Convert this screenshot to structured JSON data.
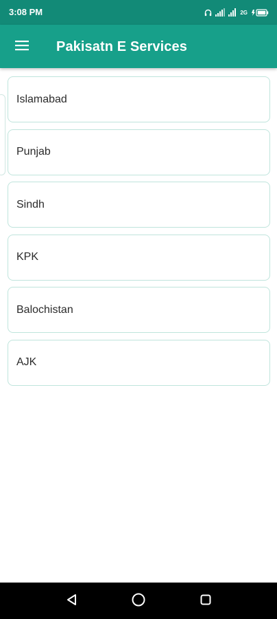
{
  "status_bar": {
    "time": "3:08 PM",
    "network_label": "2G",
    "icons": [
      "headphones-icon",
      "signal-icon",
      "network-type-icon",
      "battery-icon"
    ]
  },
  "app_bar": {
    "title": "Pakisatn E Services",
    "menu_icon": "hamburger-menu-icon",
    "background_color": "#17a08a",
    "status_color": "#128a77"
  },
  "provinces": [
    {
      "label": "Islamabad"
    },
    {
      "label": "Punjab"
    },
    {
      "label": "Sindh"
    },
    {
      "label": "KPK"
    },
    {
      "label": "Balochistan"
    },
    {
      "label": "AJK"
    }
  ],
  "nav_bar": {
    "back_icon": "back-triangle-icon",
    "home_icon": "home-circle-icon",
    "recent_icon": "recent-apps-square-icon"
  }
}
